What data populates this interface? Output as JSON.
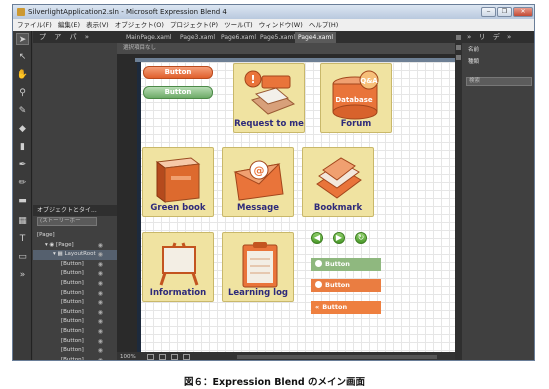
{
  "window": {
    "title": "SilverlightApplication2.sln - Microsoft Expression Blend 4",
    "controls": [
      "‒",
      "❐",
      "✕"
    ]
  },
  "menu": [
    "ファイル(F)",
    "編集(E)",
    "表示(V)",
    "オブジェクト(O)",
    "プロジェクト(P)",
    "ツール(T)",
    "ウィンドウ(W)",
    "ヘルプ(H)"
  ],
  "left_panel": {
    "tabs": [
      "プ",
      "ア",
      "パ",
      "»"
    ],
    "objects_header": "オブジェクトとタイ...",
    "storyboard": "(ストーリーボー",
    "tree": [
      {
        "label": "[Page]",
        "indent": 0
      },
      {
        "label": "▾ ◉ [Page]",
        "indent": 1
      },
      {
        "label": "▾ ▦ LayoutRoot",
        "indent": 2
      },
      {
        "label": "[Button]",
        "indent": 3
      },
      {
        "label": "[Button]",
        "indent": 3
      },
      {
        "label": "[Button]",
        "indent": 3
      },
      {
        "label": "[Button]",
        "indent": 3
      },
      {
        "label": "[Button]",
        "indent": 3
      },
      {
        "label": "[Button]",
        "indent": 3
      },
      {
        "label": "[Button]",
        "indent": 3
      },
      {
        "label": "[Button]",
        "indent": 3
      },
      {
        "label": "[Button]",
        "indent": 3
      },
      {
        "label": "[Button]",
        "indent": 3
      },
      {
        "label": "[Button]",
        "indent": 3
      },
      {
        "label": "[Button]",
        "indent": 3
      }
    ]
  },
  "doc_tabs": [
    "MainPage.xaml",
    "Page3.xaml",
    "Page6.xaml",
    "Page5.xaml",
    "Page4.xaml"
  ],
  "active_tab": "Page4.xaml",
  "breadcrumb": "選択項目なし",
  "canvas": {
    "pill_buttons": [
      {
        "label": "Button",
        "style": "orange"
      },
      {
        "label": "Button",
        "style": "green"
      }
    ],
    "tiles": [
      {
        "label": "Request to me",
        "art_text": "!"
      },
      {
        "label": "Forum",
        "art_text": "Q&A",
        "art_sub": "Database"
      },
      {
        "label": "Green book"
      },
      {
        "label": "Message",
        "art_text": "@"
      },
      {
        "label": "Bookmark"
      },
      {
        "label": "Information"
      },
      {
        "label": "Learning log"
      }
    ],
    "round_buttons": [
      "◀",
      "▶",
      "↻"
    ],
    "flat_buttons": [
      {
        "label": "Button",
        "icon": "play",
        "style": "green"
      },
      {
        "label": "Button",
        "icon": "play",
        "style": "orange"
      },
      {
        "label": "Button",
        "icon": "rewind",
        "style": "orange2"
      }
    ]
  },
  "status": {
    "zoom": "100%"
  },
  "right_panel": {
    "tabs": [
      "»",
      "リ",
      "デ",
      "»"
    ],
    "name_label": "名前",
    "type_label": "種類",
    "search_placeholder": "検索"
  },
  "caption": "図６：Expression Blend のメイン画面",
  "colors": {
    "tile_bg": "#f0e3a1",
    "tile_label": "#2e2a7a",
    "orange": "#e0602c",
    "green": "#6daa67",
    "chrome": "#3c3c3c"
  }
}
